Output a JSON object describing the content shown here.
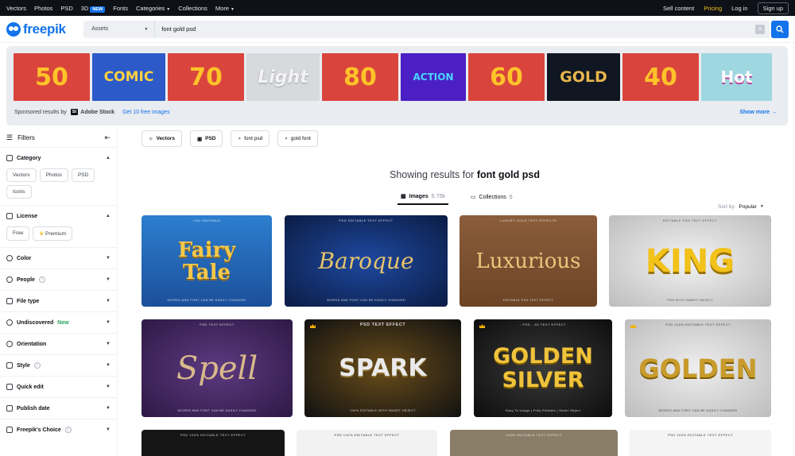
{
  "topbar": {
    "nav": [
      "Vectors",
      "Photos",
      "PSD",
      "3D",
      "Fonts",
      "Categories",
      "Collections",
      "More"
    ],
    "new_badge": "NEW",
    "sell": "Sell content",
    "pricing": "Pricing",
    "login": "Log in",
    "signup": "Sign up"
  },
  "header": {
    "logo": "freepik",
    "asset_type": "Assets",
    "query": "font gold psd",
    "clear": "×"
  },
  "sponsored": {
    "tiles": [
      "50",
      "COMIC",
      "70",
      "Light",
      "80",
      "ACTION",
      "60",
      "GOLD",
      "40",
      "Hot"
    ],
    "label": "Sponsored results by",
    "stock_badge": "St",
    "stock_name": "Adobe Stock",
    "free_link": "Get 10 free images",
    "show_more": "Show more",
    "arrow": "→"
  },
  "sidebar": {
    "title": "Filters",
    "collapse": "⇤",
    "category": {
      "title": "Category",
      "chips": [
        "Vectors",
        "Photos",
        "PSD",
        "Icons"
      ]
    },
    "license": {
      "title": "License",
      "chips": [
        "Free",
        "Premium"
      ]
    },
    "items": [
      "Color",
      "People",
      "File type",
      "Undiscovered",
      "Orientation",
      "Style",
      "Quick edit",
      "Publish date",
      "Freepik's Choice"
    ],
    "new_tag": "New",
    "info_glyph": "i"
  },
  "related": [
    "Vectors",
    "PSD",
    "font psd",
    "gold font"
  ],
  "results": {
    "prefix": "Showing results for",
    "query": "font gold psd",
    "tabs": [
      {
        "label": "Images",
        "count": "6.75k"
      },
      {
        "label": "Collections",
        "count": "6"
      }
    ],
    "sort_label": "Sort by:",
    "sort_value": "Popular"
  },
  "cards": [
    {
      "title": "Fairy Tale",
      "top": "YOU EDITABLE",
      "bottom": "WORDS AND FONT CAN BE EASILY CHANGED"
    },
    {
      "title": "Baroque",
      "top": "PSD EDITABLE TEXT EFFECT",
      "bottom": "WORDS AND FONT CAN BE EASILY CHANGED"
    },
    {
      "title": "Luxurious",
      "top": "LUXURY GOLD TEXT EFFECTS",
      "bottom": "EDITABLE PSD TEXT EFFECT"
    },
    {
      "title": "KING",
      "top": "EDITABLE PSD TEXT EFFECT",
      "bottom": "PSD WITH SMART OBJECT"
    },
    {
      "title": "Spell",
      "top": "PSD TEXT EFFECT",
      "bottom": "WORDS AND FONT CAN BE EASILY CHANGED"
    },
    {
      "title": "SPARK",
      "top": "PSD TEXT EFFECT",
      "bottom": "100% EDITABLE WITH SMART OBJECT"
    },
    {
      "title": "GOLDEN SILVER",
      "top": "- PSD - 3D TEXT EFFECT",
      "bottom": "Easy To Usage | Fully Editable | Smart Object"
    },
    {
      "title": "GOLDEN",
      "top": "PSD 100% EDITABLE TEXT EFFECT",
      "bottom": "WORDS AND FONT CAN BE EASILY CHANGED"
    },
    {
      "title": "",
      "top": "PSD 100% EDITABLE TEXT EFFECT",
      "bottom": ""
    },
    {
      "title": "",
      "top": "PSD 100% EDITABLE TEXT EFFECT",
      "bottom": ""
    },
    {
      "title": "",
      "top": "100% EDITABLE TEXT EFFECT",
      "bottom": ""
    },
    {
      "title": "",
      "top": "PSD 100% EDITABLE TEXT EFFECT",
      "bottom": ""
    }
  ],
  "colors": {
    "brand": "#1273eb",
    "topbar": "#0e1117",
    "pricing": "#f5c518",
    "new_green": "#26a65b"
  },
  "icons": [
    "search-icon",
    "filter-icon",
    "collapse-icon",
    "chevron-up-icon",
    "chevron-down-icon",
    "category-icon",
    "license-icon",
    "color-icon",
    "people-icon",
    "file-icon",
    "eye-icon",
    "orientation-icon",
    "style-icon",
    "quick-edit-icon",
    "calendar-icon",
    "freepik-choice-icon",
    "images-icon",
    "collections-icon",
    "crown-icon",
    "arrow-right-icon"
  ]
}
